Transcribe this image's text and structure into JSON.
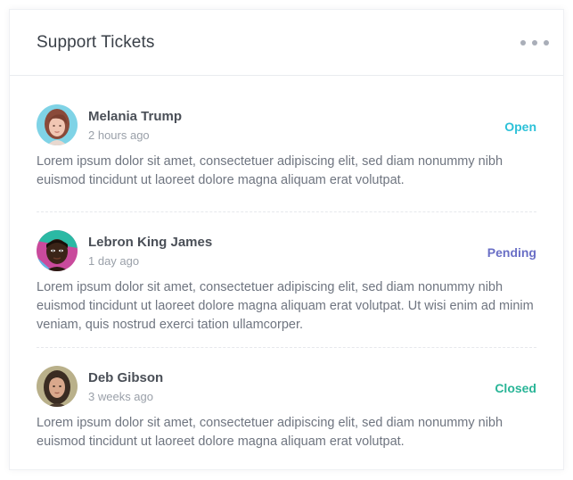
{
  "card": {
    "title": "Support Tickets",
    "menu_icon": "more-horizontal-icon"
  },
  "tickets": [
    {
      "name": "Melania Trump",
      "time": "2 hours ago",
      "status": "Open",
      "status_color": "#2cc1d8",
      "body": "Lorem ipsum dolor sit amet, consectetuer adipiscing elit, sed diam nonummy nibh euismod tincidunt ut laoreet dolore magna aliquam erat volutpat."
    },
    {
      "name": "Lebron King James",
      "time": "1 day ago",
      "status": "Pending",
      "status_color": "#6a6fc6",
      "body": "Lorem ipsum dolor sit amet, consectetuer adipiscing elit, sed diam nonummy nibh euismod tincidunt ut laoreet dolore magna aliquam erat volutpat. Ut wisi enim ad minim veniam, quis nostrud exerci tation ullamcorper."
    },
    {
      "name": "Deb Gibson",
      "time": "3 weeks ago",
      "status": "Closed",
      "status_color": "#29b597",
      "body": "Lorem ipsum dolor sit amet, consectetuer adipiscing elit, sed diam nonummy nibh euismod tincidunt ut laoreet dolore magna aliquam erat volutpat."
    }
  ]
}
